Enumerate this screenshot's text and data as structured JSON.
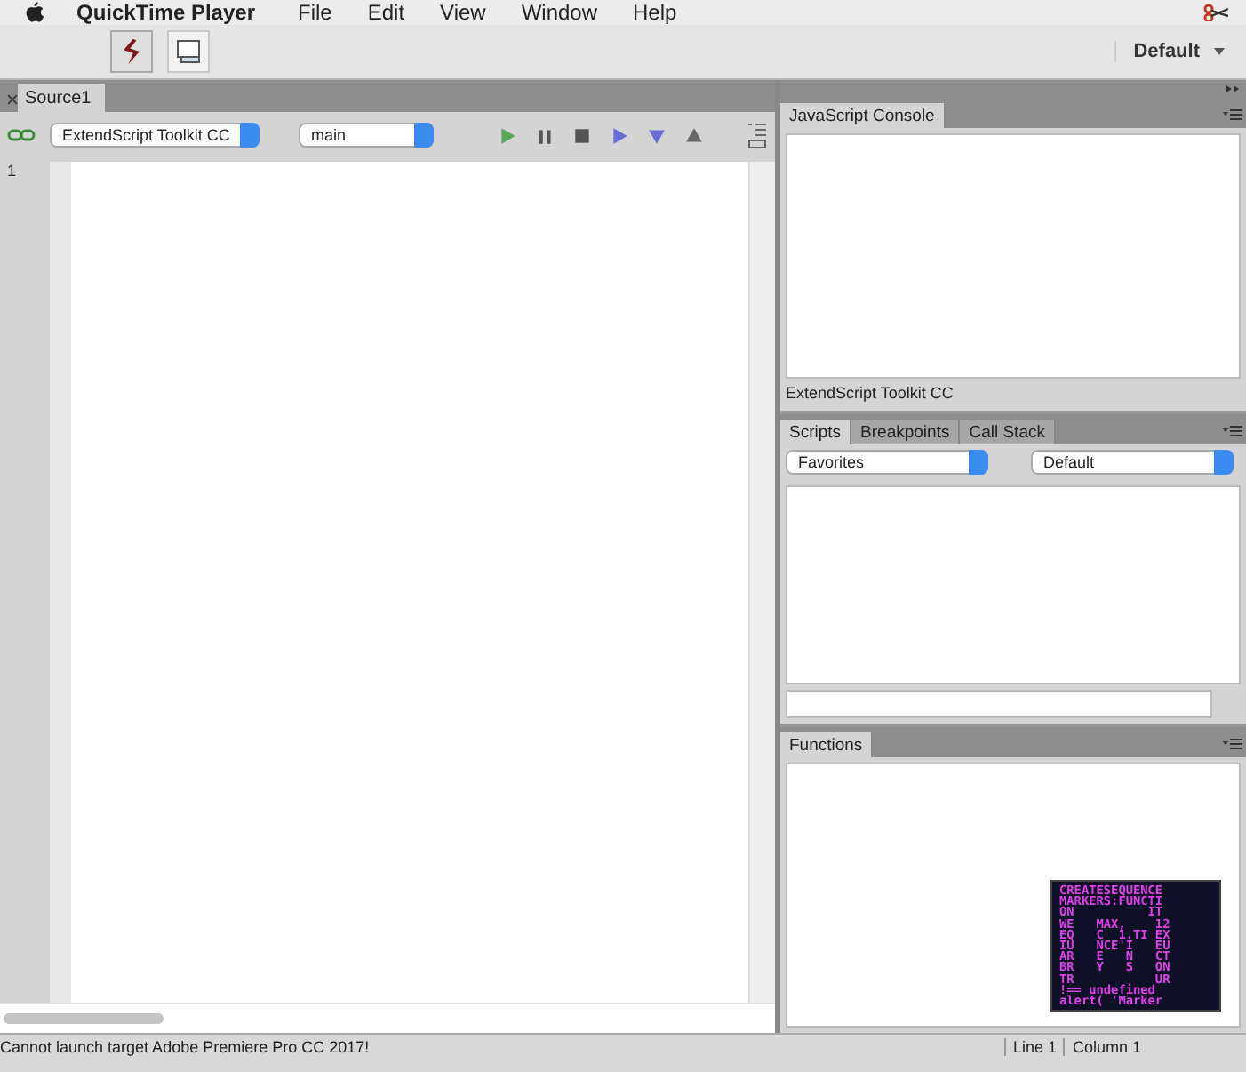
{
  "menu_bar": {
    "app_name": "QuickTime Player",
    "items": [
      "File",
      "Edit",
      "View",
      "Window",
      "Help"
    ]
  },
  "toolbar": {
    "workspace": "Default"
  },
  "editor": {
    "tab": "Source1",
    "target": "ExtendScript Toolkit CC",
    "engine": "main",
    "line_numbers": [
      "1"
    ]
  },
  "console": {
    "tab": "JavaScript Console",
    "footer": "ExtendScript Toolkit CC"
  },
  "scripts_panel": {
    "tabs": [
      {
        "label": "Scripts",
        "selected": true
      },
      {
        "label": "Breakpoints",
        "selected": false
      },
      {
        "label": "Call Stack",
        "selected": false
      }
    ],
    "category": "Favorites",
    "scope": "Default"
  },
  "functions_panel": {
    "tab": "Functions"
  },
  "status_bar": {
    "message": "Cannot launch target Adobe Premiere Pro CC 2017!",
    "line": "Line 1",
    "column": "Column 1"
  },
  "overlay": {
    "lines": [
      "CREATESEQUENCE",
      "MARKERS:FUNCTI",
      "ON          IT",
      "WE   MAX,    12",
      "EQ   C  1.TI EX",
      "IU   NCE'I   EU",
      "AR   E   N   CT",
      "BR   Y   S   ON",
      "TR           UR",
      "!== undefined",
      "alert( 'Marker"
    ]
  }
}
